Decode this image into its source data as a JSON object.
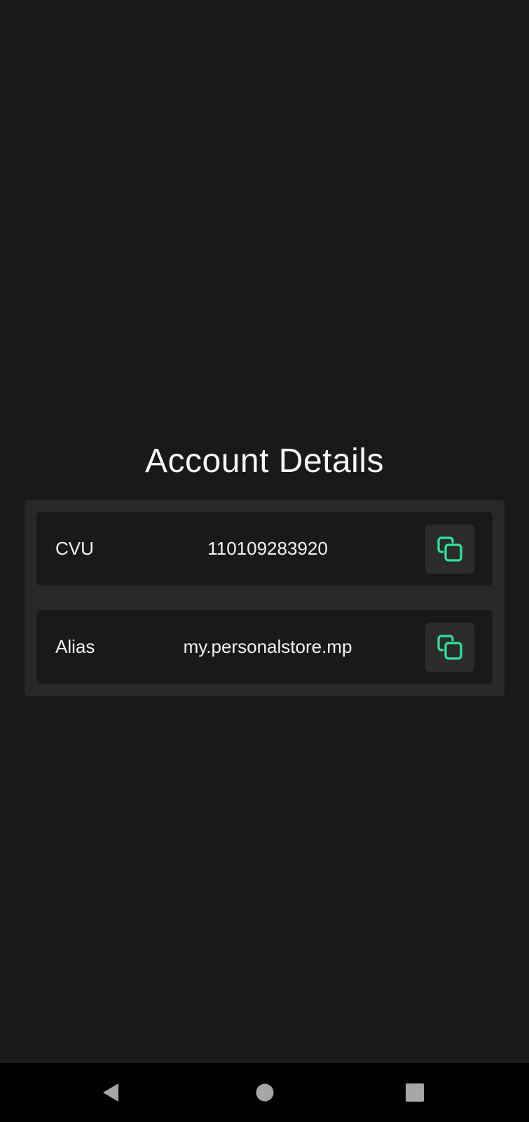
{
  "page": {
    "title": "Account Details"
  },
  "details": {
    "rows": [
      {
        "label": "CVU",
        "value": "110109283920",
        "action_icon": "copy-icon"
      },
      {
        "label": "Alias",
        "value": "my.personalstore.mp",
        "action_icon": "copy-icon"
      }
    ]
  },
  "navigation": {
    "buttons": [
      {
        "name": "back",
        "icon": "triangle-back-icon"
      },
      {
        "name": "home",
        "icon": "circle-home-icon"
      },
      {
        "name": "recents",
        "icon": "square-recents-icon"
      }
    ]
  },
  "colors": {
    "background": "#181918",
    "card": "#272827",
    "row": "#181918",
    "accent": "#2EE59D",
    "text": "#F4F4F4",
    "nav_bar": "#000000",
    "nav_icon": "#A6A6A6"
  }
}
